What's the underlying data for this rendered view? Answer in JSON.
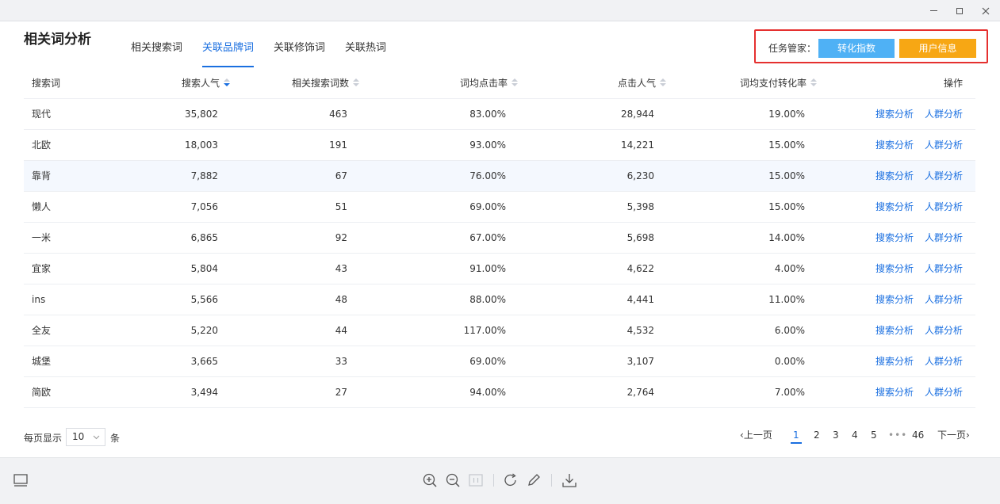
{
  "page": {
    "title": "相关词分析"
  },
  "tabs": [
    {
      "label": "相关搜索词",
      "active": false
    },
    {
      "label": "关联品牌词",
      "active": true
    },
    {
      "label": "关联修饰词",
      "active": false
    },
    {
      "label": "关联热词",
      "active": false
    }
  ],
  "task": {
    "label": "任务管家：",
    "convert_label": "转化指数",
    "user_label": "用户信息"
  },
  "table": {
    "headers": [
      "搜索词",
      "搜索人气",
      "相关搜索词数",
      "词均点击率",
      "点击人气",
      "词均支付转化率",
      "操作"
    ],
    "rows": [
      {
        "term": "现代",
        "popularity": "35,802",
        "related": "463",
        "ctr": "83.00%",
        "clicks": "28,944",
        "conv": "19.00%"
      },
      {
        "term": "北欧",
        "popularity": "18,003",
        "related": "191",
        "ctr": "93.00%",
        "clicks": "14,221",
        "conv": "15.00%"
      },
      {
        "term": "靠背",
        "popularity": "7,882",
        "related": "67",
        "ctr": "76.00%",
        "clicks": "6,230",
        "conv": "15.00%"
      },
      {
        "term": "懒人",
        "popularity": "7,056",
        "related": "51",
        "ctr": "69.00%",
        "clicks": "5,398",
        "conv": "15.00%"
      },
      {
        "term": "一米",
        "popularity": "6,865",
        "related": "92",
        "ctr": "67.00%",
        "clicks": "5,698",
        "conv": "14.00%"
      },
      {
        "term": "宜家",
        "popularity": "5,804",
        "related": "43",
        "ctr": "91.00%",
        "clicks": "4,622",
        "conv": "4.00%"
      },
      {
        "term": "ins",
        "popularity": "5,566",
        "related": "48",
        "ctr": "88.00%",
        "clicks": "4,441",
        "conv": "11.00%"
      },
      {
        "term": "全友",
        "popularity": "5,220",
        "related": "44",
        "ctr": "117.00%",
        "clicks": "4,532",
        "conv": "6.00%"
      },
      {
        "term": "城堡",
        "popularity": "3,665",
        "related": "33",
        "ctr": "69.00%",
        "clicks": "3,107",
        "conv": "0.00%"
      },
      {
        "term": "简欧",
        "popularity": "3,494",
        "related": "27",
        "ctr": "94.00%",
        "clicks": "2,764",
        "conv": "7.00%"
      }
    ],
    "action_search": "搜索分析",
    "action_crowd": "人群分析"
  },
  "pagination": {
    "per_page_label": "每页显示",
    "per_page_value": "10",
    "per_page_unit": "条",
    "prev": "上一页",
    "next": "下一页",
    "pages": [
      "1",
      "2",
      "3",
      "4",
      "5"
    ],
    "dots": "•••",
    "last": "46",
    "current": "1"
  },
  "colors": {
    "accent": "#1a6fe0",
    "convert_button": "#4fb1f5",
    "user_button": "#f7a714",
    "highlight_box": "#e5302f"
  }
}
